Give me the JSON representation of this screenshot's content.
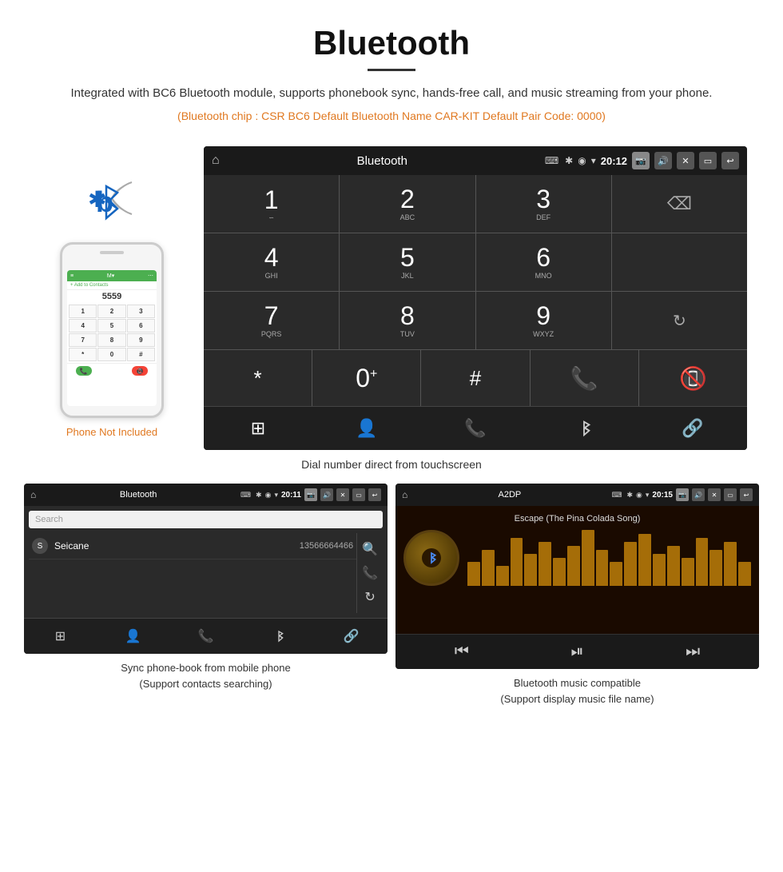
{
  "page": {
    "title": "Bluetooth",
    "description": "Integrated with BC6 Bluetooth module, supports phonebook sync, hands-free call, and music streaming from your phone.",
    "specs": "(Bluetooth chip : CSR BC6    Default Bluetooth Name CAR-KIT    Default Pair Code: 0000)",
    "dial_caption": "Dial number direct from touchscreen",
    "phonebook_caption": "Sync phone-book from mobile phone\n(Support contacts searching)",
    "music_caption": "Bluetooth music compatible\n(Support display music file name)"
  },
  "statusbar": {
    "title": "Bluetooth",
    "time": "20:12",
    "usb_icon": "⌨",
    "bt_icon": "✱",
    "location_icon": "◉",
    "signal_icon": "▼",
    "camera_icon": "📷",
    "volume_icon": "🔊",
    "close_icon": "✕",
    "screen_icon": "▭",
    "back_icon": "↩"
  },
  "statusbar2": {
    "title": "Bluetooth",
    "time": "20:11"
  },
  "statusbar3": {
    "title": "A2DP",
    "time": "20:15"
  },
  "dialpad": {
    "keys": [
      {
        "num": "1",
        "letters": ""
      },
      {
        "num": "2",
        "letters": "ABC"
      },
      {
        "num": "3",
        "letters": "DEF"
      },
      {
        "num": "4",
        "letters": "GHI"
      },
      {
        "num": "5",
        "letters": "JKL"
      },
      {
        "num": "6",
        "letters": "MNO"
      },
      {
        "num": "7",
        "letters": "PQRS"
      },
      {
        "num": "8",
        "letters": "TUV"
      },
      {
        "num": "9",
        "letters": "WXYZ"
      },
      {
        "num": "*",
        "letters": ""
      },
      {
        "num": "0",
        "letters": "+"
      },
      {
        "num": "#",
        "letters": ""
      }
    ]
  },
  "phone_not_included": "Phone Not Included",
  "contact": {
    "letter": "S",
    "name": "Seicane",
    "phone": "13566664466"
  },
  "search_placeholder": "Search",
  "music": {
    "title": "Escape (The Pina Colada Song)",
    "eq_bars": [
      30,
      45,
      25,
      60,
      40,
      55,
      35,
      50,
      70,
      45,
      30,
      55,
      65,
      40,
      50,
      35,
      60,
      45,
      55,
      30
    ]
  },
  "phone_mock": {
    "keys": [
      "1",
      "2",
      "3",
      "4",
      "5",
      "6",
      "7",
      "8",
      "9",
      "*",
      "0",
      "#"
    ]
  }
}
